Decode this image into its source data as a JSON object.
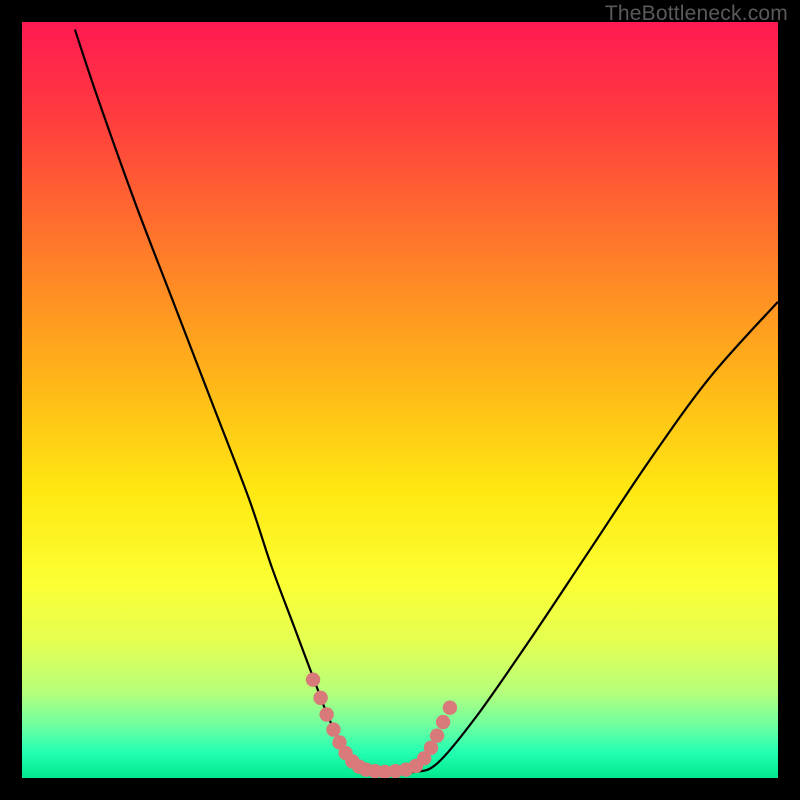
{
  "watermark": {
    "text": "TheBottleneck.com"
  },
  "colors": {
    "black": "#000000",
    "curve": "#000000",
    "marker": "#d97a7a",
    "marker_stroke": "#d97a7a",
    "gradient_stops": [
      {
        "offset": 0.0,
        "color": "#ff1a52"
      },
      {
        "offset": 0.12,
        "color": "#ff3a3f"
      },
      {
        "offset": 0.3,
        "color": "#ff7a2a"
      },
      {
        "offset": 0.48,
        "color": "#ffb818"
      },
      {
        "offset": 0.62,
        "color": "#ffe812"
      },
      {
        "offset": 0.74,
        "color": "#fcff33"
      },
      {
        "offset": 0.82,
        "color": "#e4ff52"
      },
      {
        "offset": 0.885,
        "color": "#b7ff7a"
      },
      {
        "offset": 0.93,
        "color": "#70ffa0"
      },
      {
        "offset": 0.965,
        "color": "#25ffb2"
      },
      {
        "offset": 1.0,
        "color": "#00e88f"
      }
    ]
  },
  "chart_data": {
    "type": "line",
    "title": "",
    "xlabel": "",
    "ylabel": "",
    "xlim": [
      0,
      100
    ],
    "ylim": [
      0,
      100
    ],
    "grid": false,
    "legend": false,
    "series": [
      {
        "name": "bottleneck-curve",
        "x": [
          7,
          10,
          15,
          20,
          25,
          30,
          33,
          36,
          39,
          41,
          44,
          48,
          52,
          55,
          60,
          67,
          75,
          83,
          91,
          100
        ],
        "y": [
          99,
          90,
          76,
          63,
          50,
          37,
          28,
          20,
          12,
          7,
          2,
          0.8,
          0.8,
          2,
          8,
          18,
          30,
          42,
          53,
          63
        ]
      }
    ],
    "annotations": [
      {
        "name": "optimal-range-markers",
        "x": [
          38.5,
          39.5,
          40.3,
          41.2,
          42.0,
          42.8,
          43.7,
          44.6,
          45.5,
          46.7,
          48.0,
          49.4,
          50.8,
          52.1,
          53.2,
          54.1,
          54.9,
          55.7,
          56.6
        ],
        "y": [
          13.0,
          10.6,
          8.4,
          6.4,
          4.7,
          3.3,
          2.2,
          1.5,
          1.1,
          0.9,
          0.8,
          0.9,
          1.1,
          1.6,
          2.6,
          4.0,
          5.6,
          7.4,
          9.3
        ]
      }
    ]
  }
}
